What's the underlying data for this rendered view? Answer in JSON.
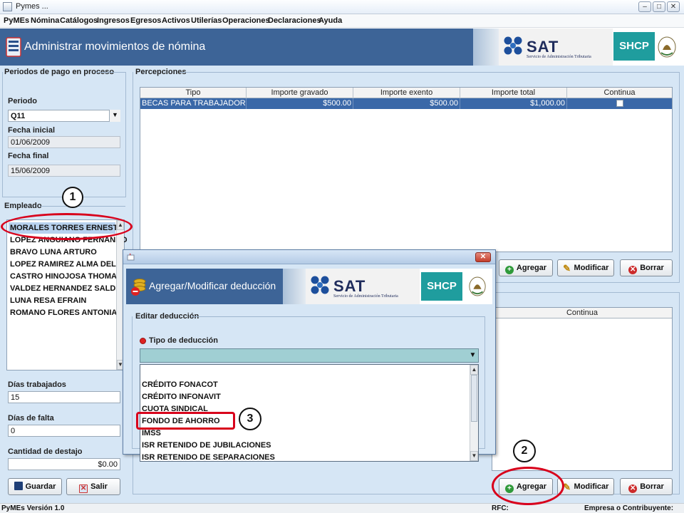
{
  "window": {
    "title": "Pymes ...",
    "min": "–",
    "max": "□",
    "close": "✕"
  },
  "menu": [
    "PyMEs",
    "Nómina",
    "Catálogos",
    "Ingresos",
    "Egresos",
    "Activos",
    "Utilerías",
    "Operaciones",
    "Declaraciones",
    "Ayuda"
  ],
  "banner": {
    "title": "Administrar movimientos de nómina",
    "sat": "SAT",
    "sat_sub": "Servicio de Administración Tributaria",
    "shcp": "SHCP"
  },
  "periodos": {
    "group_title": "Periodos de pago en proceso",
    "periodo_label": "Periodo",
    "periodo_value": "Q11",
    "fecha_inicial_label": "Fecha inicial",
    "fecha_inicial_value": "01/06/2009",
    "fecha_final_label": "Fecha final",
    "fecha_final_value": "15/06/2009"
  },
  "empleado": {
    "group_title": "Empleado",
    "items": [
      "MORALES TORRES ERNESTO",
      "LOPEZ ANGUIANO FERNANDO",
      "BRAVO LUNA ARTURO",
      "LOPEZ RAMIREZ ALMA DELIA",
      "CASTRO HINOJOSA THOMAS",
      "VALDEZ HERNANDEZ SALDRA",
      "LUNA RESA EFRAIN",
      "ROMANO FLORES ANTONIA"
    ]
  },
  "dias_trabajados": {
    "label": "Días trabajados",
    "value": "15"
  },
  "dias_falta": {
    "label": "Días de falta",
    "value": "0"
  },
  "destajo": {
    "label": "Cantidad de destajo",
    "value": "$0.00"
  },
  "left_buttons": {
    "guardar": "Guardar",
    "salir": "Salir"
  },
  "percepciones": {
    "group_title": "Percepciones",
    "columns": [
      "Tipo",
      "Importe gravado",
      "Importe exento",
      "Importe total",
      "Continua"
    ],
    "rows": [
      {
        "tipo": "BECAS PARA TRABAJADORES Y/...",
        "gravado": "$500.00",
        "exento": "$500.00",
        "total": "$1,000.00"
      }
    ],
    "buttons": {
      "agregar": "Agregar",
      "modificar": "Modificar",
      "borrar": "Borrar"
    }
  },
  "deducciones": {
    "continua_header": "Continua",
    "buttons": {
      "agregar": "Agregar",
      "modificar": "Modificar",
      "borrar": "Borrar"
    }
  },
  "dialog": {
    "title": "Agregar/Modificar deducción",
    "group_title": "Editar deducción",
    "tipo_label": "Tipo de deducción",
    "options": [
      "CRÉDITO FONACOT",
      "CRÉDITO INFONAVIT",
      "CUOTA SINDICAL",
      "FONDO DE AHORRO",
      "IMSS",
      "ISR RETENIDO DE JUBILACIONES",
      "ISR RETENIDO DE SEPARACIONES"
    ]
  },
  "status": {
    "version": "PyMEs Versión 1.0",
    "rfc": "RFC:",
    "empresa": "Empresa o Contribuyente:"
  },
  "callouts": [
    "1",
    "2",
    "3"
  ],
  "colors": {
    "banner_blue": "#3d6497",
    "panel": "#d6e6f5",
    "shcp": "#1f9d9e",
    "highlight_red": "#d8001b",
    "selection": "#3a68a8"
  }
}
